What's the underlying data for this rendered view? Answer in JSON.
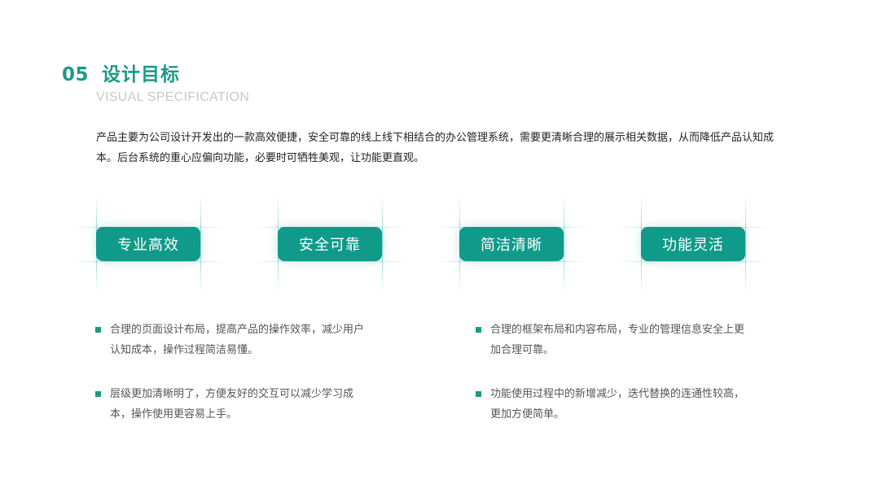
{
  "header": {
    "number": "05",
    "title": "设计目标",
    "subtitle": "VISUAL SPECIFICATION"
  },
  "intro": "产品主要为公司设计开发出的一款高效便捷，安全可靠的线上线下相结合的办公管理系统，需要更清晰合理的展示相关数据，从而降低产品认知成本。后台系统的重心应偏向功能，必要时可牺牲美观，让功能更直观。",
  "tags": [
    {
      "label": "专业高效"
    },
    {
      "label": "安全可靠"
    },
    {
      "label": "简洁清晰"
    },
    {
      "label": "功能灵活"
    }
  ],
  "bullets": [
    {
      "text": "合理的页面设计布局，提高产品的操作效率，减少用户认知成本，操作过程简洁易懂。"
    },
    {
      "text": "合理的框架布局和内容布局，专业的管理信息安全上更加合理可靠。"
    },
    {
      "text": "层级更加清晰明了，方便友好的交互可以减少学习成本，操作使用更容易上手。"
    },
    {
      "text": "功能使用过程中的新增减少，迭代替换的连通性较高，更加方便简单。"
    }
  ],
  "colors": {
    "accent": "#1a9a86",
    "tag_bg": "#0f9a8a"
  }
}
